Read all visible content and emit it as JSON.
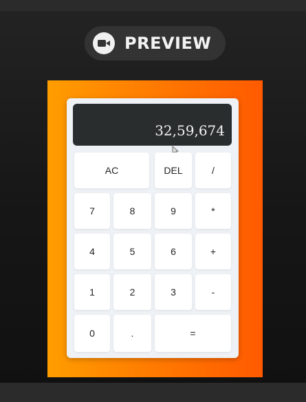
{
  "header": {
    "preview_label": "PREVIEW",
    "icon": "video-camera-icon"
  },
  "colors": {
    "frame_gradient_start": "#ff9d00",
    "frame_gradient_end": "#ff5a00",
    "display_bg": "#2a2d2e",
    "keypad_bg": "#eef1f5"
  },
  "calculator": {
    "display_value": "32,59,674",
    "keys": {
      "ac": "AC",
      "del": "DEL",
      "divide": "/",
      "seven": "7",
      "eight": "8",
      "nine": "9",
      "multiply": "*",
      "four": "4",
      "five": "5",
      "six": "6",
      "plus": "+",
      "one": "1",
      "two": "2",
      "three": "3",
      "minus": "-",
      "zero": "0",
      "dot": ".",
      "equals": "="
    }
  }
}
